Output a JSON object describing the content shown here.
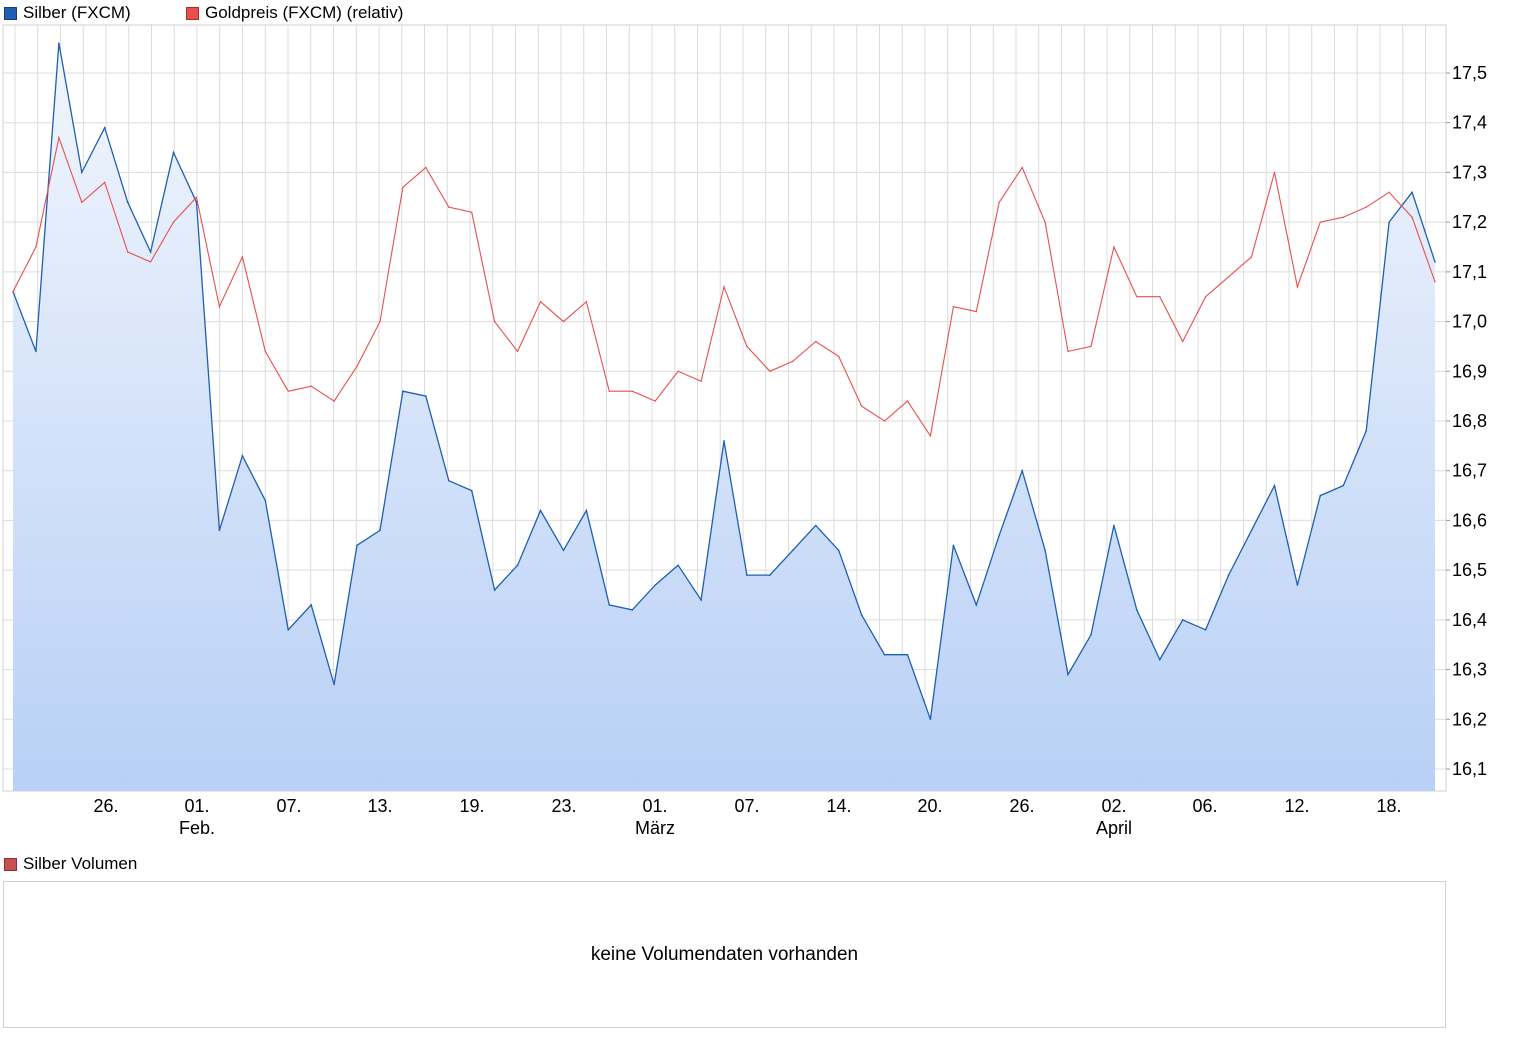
{
  "legend": {
    "silver": {
      "label": "Silber (FXCM)",
      "color": "#1f5fb3"
    },
    "gold": {
      "label": "Goldpreis (FXCM) (relativ)",
      "color": "#e8504f"
    }
  },
  "volume": {
    "label": "Silber Volumen",
    "color": "#c95050",
    "message": "keine Volumendaten vorhanden"
  },
  "chart_data": {
    "type": "line",
    "y_axis_side": "right",
    "ylim": [
      16.05,
      17.6
    ],
    "y_ticks": [
      "16,1",
      "16,2",
      "16,3",
      "16,4",
      "16,5",
      "16,6",
      "16,7",
      "16,8",
      "16,9",
      "17,0",
      "17,1",
      "17,2",
      "17,3",
      "17,4",
      "17,5"
    ],
    "x_ticks": [
      "26.",
      "01.",
      "07.",
      "13.",
      "19.",
      "23.",
      "01.",
      "07.",
      "14.",
      "20.",
      "26.",
      "02.",
      "06.",
      "12.",
      "18."
    ],
    "x_month_labels": [
      {
        "tick_index": 1,
        "label": "Feb."
      },
      {
        "tick_index": 6,
        "label": "März"
      },
      {
        "tick_index": 11,
        "label": "April"
      }
    ],
    "grid": true,
    "legend_position": "top-left",
    "series": [
      {
        "name": "Silber (FXCM)",
        "fill": "area",
        "values": [
          17.06,
          16.94,
          17.56,
          17.3,
          17.39,
          17.24,
          17.14,
          17.34,
          17.24,
          16.58,
          16.73,
          16.64,
          16.38,
          16.43,
          16.27,
          16.55,
          16.58,
          16.86,
          16.85,
          16.68,
          16.66,
          16.46,
          16.51,
          16.62,
          16.54,
          16.62,
          16.43,
          16.42,
          16.47,
          16.51,
          16.44,
          16.76,
          16.49,
          16.49,
          16.54,
          16.59,
          16.54,
          16.41,
          16.33,
          16.33,
          16.2,
          16.55,
          16.43,
          16.57,
          16.7,
          16.54,
          16.29,
          16.37,
          16.59,
          16.42,
          16.32,
          16.4,
          16.38,
          16.49,
          16.58,
          16.67,
          16.47,
          16.65,
          16.67,
          16.78,
          17.2,
          17.26,
          17.12
        ]
      },
      {
        "name": "Goldpreis (FXCM) (relativ)",
        "fill": "none",
        "values": [
          17.06,
          17.15,
          17.37,
          17.24,
          17.28,
          17.14,
          17.12,
          17.2,
          17.25,
          17.03,
          17.13,
          16.94,
          16.86,
          16.87,
          16.84,
          16.91,
          17.0,
          17.27,
          17.31,
          17.23,
          17.22,
          17.0,
          16.94,
          17.04,
          17.0,
          17.04,
          16.86,
          16.86,
          16.84,
          16.9,
          16.88,
          17.07,
          16.95,
          16.9,
          16.92,
          16.96,
          16.93,
          16.83,
          16.8,
          16.84,
          16.77,
          17.03,
          17.02,
          17.24,
          17.31,
          17.2,
          16.94,
          16.95,
          17.15,
          17.05,
          17.05,
          16.96,
          17.05,
          17.09,
          17.13,
          17.3,
          17.07,
          17.2,
          17.21,
          17.23,
          17.26,
          17.21,
          17.08
        ]
      }
    ]
  }
}
